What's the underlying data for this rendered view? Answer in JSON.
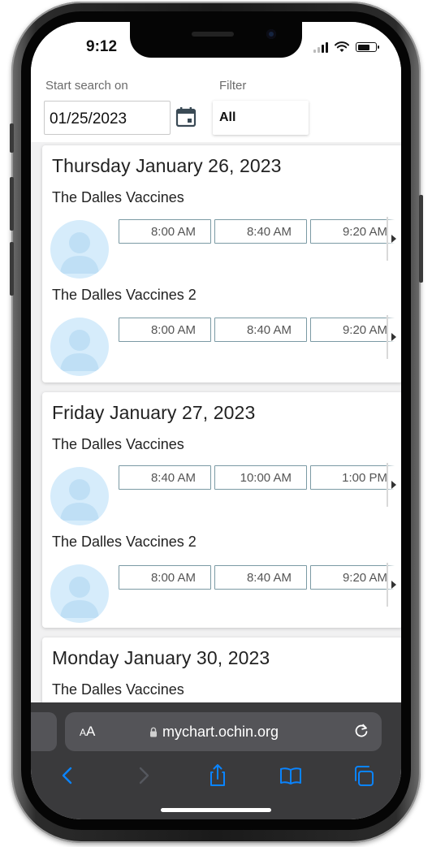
{
  "status_bar": {
    "time": "9:12"
  },
  "search": {
    "start_label": "Start search on",
    "date_value": "01/25/2023",
    "filter_label": "Filter",
    "filter_value": "All"
  },
  "days": [
    {
      "title": "Thursday January 26, 2023",
      "providers": [
        {
          "name": "The Dalles Vaccines",
          "slots": [
            "8:00 AM",
            "8:40 AM",
            "9:20 AM"
          ]
        },
        {
          "name": "The Dalles Vaccines 2",
          "slots": [
            "8:00 AM",
            "8:40 AM",
            "9:20 AM"
          ]
        }
      ]
    },
    {
      "title": "Friday January 27, 2023",
      "providers": [
        {
          "name": "The Dalles Vaccines",
          "slots": [
            "8:40 AM",
            "10:00 AM",
            "1:00 PM"
          ]
        },
        {
          "name": "The Dalles Vaccines 2",
          "slots": [
            "8:00 AM",
            "8:40 AM",
            "9:20 AM"
          ]
        }
      ]
    },
    {
      "title": "Monday January 30, 2023",
      "providers": [
        {
          "name": "The Dalles Vaccines",
          "slots": []
        }
      ]
    }
  ],
  "browser": {
    "text_size_label": "AA",
    "url": "mychart.ochin.org"
  },
  "colors": {
    "slot_border": "#7b9aa4",
    "avatar_bg": "#d6ecfb",
    "browser_bar": "#3a3a3c",
    "toolbar_active": "#0a84ff"
  },
  "icons": [
    "calendar-icon",
    "lock-icon",
    "reload-icon",
    "back-icon",
    "forward-icon",
    "share-icon",
    "bookmarks-icon",
    "tabs-icon",
    "signal-icon",
    "wifi-icon",
    "battery-icon"
  ]
}
